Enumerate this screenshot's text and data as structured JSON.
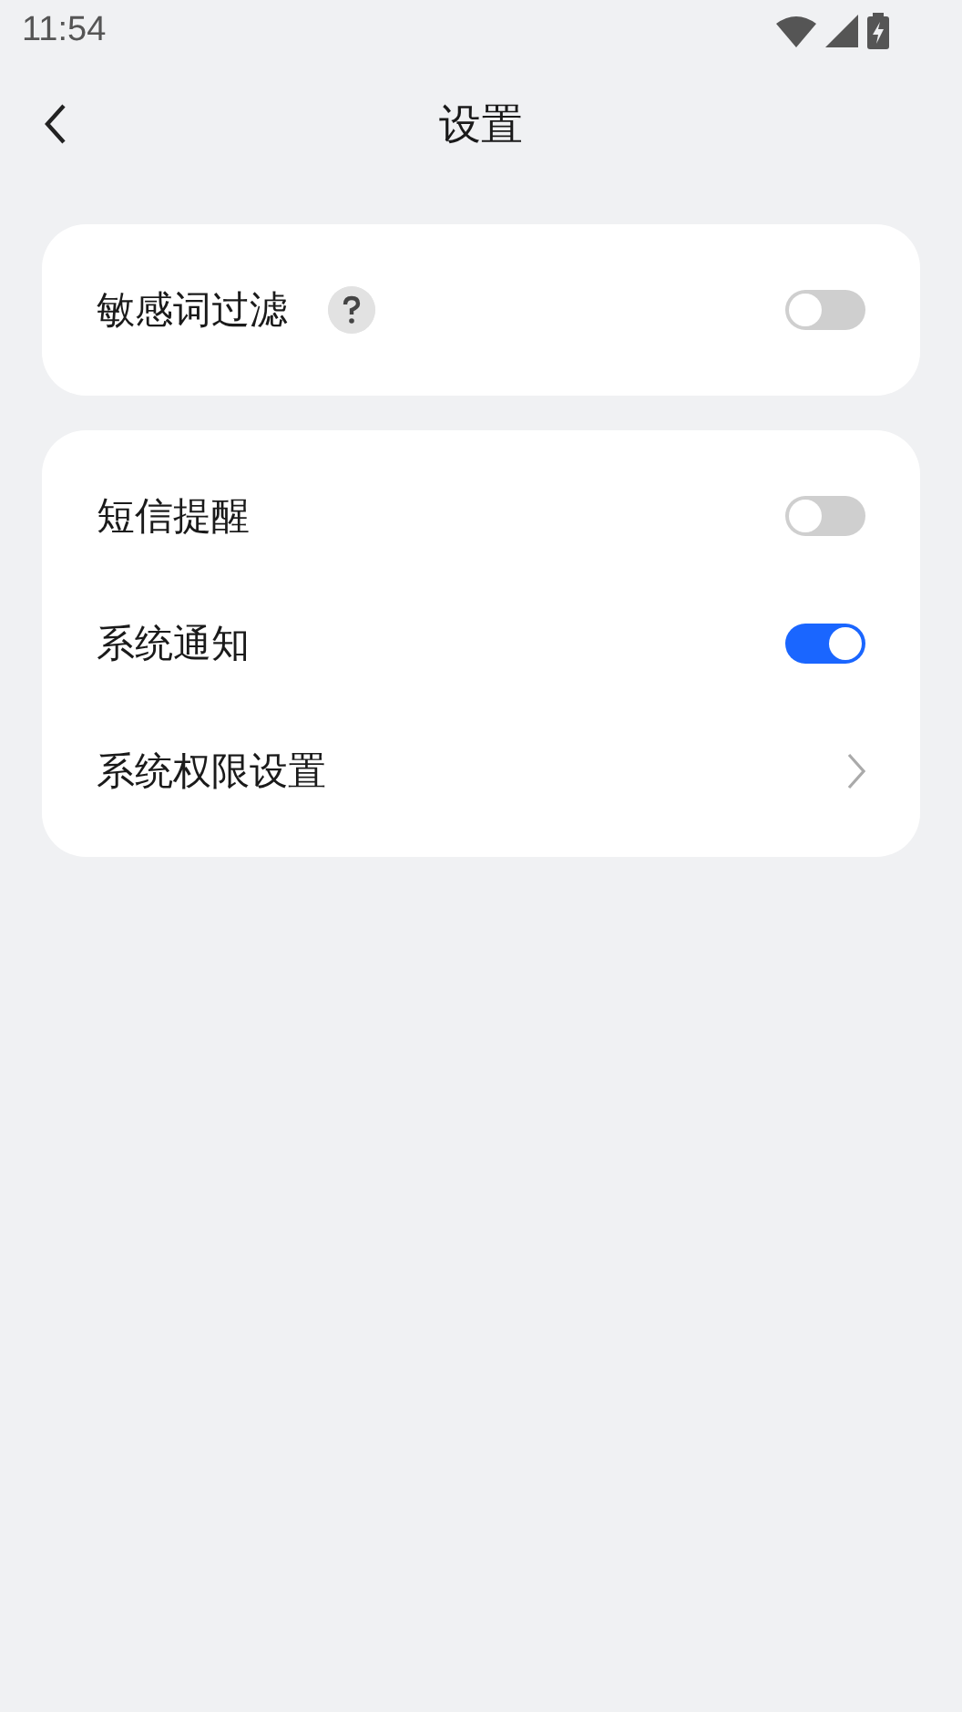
{
  "status_bar": {
    "time": "11:54"
  },
  "header": {
    "title": "设置"
  },
  "sections": [
    {
      "items": [
        {
          "kind": "toggle",
          "label": "敏感词过滤",
          "help": true,
          "on": false
        }
      ]
    },
    {
      "items": [
        {
          "kind": "toggle",
          "label": "短信提醒",
          "help": false,
          "on": false
        },
        {
          "kind": "toggle",
          "label": "系统通知",
          "help": false,
          "on": true
        },
        {
          "kind": "link",
          "label": "系统权限设置",
          "help": false
        }
      ]
    }
  ]
}
